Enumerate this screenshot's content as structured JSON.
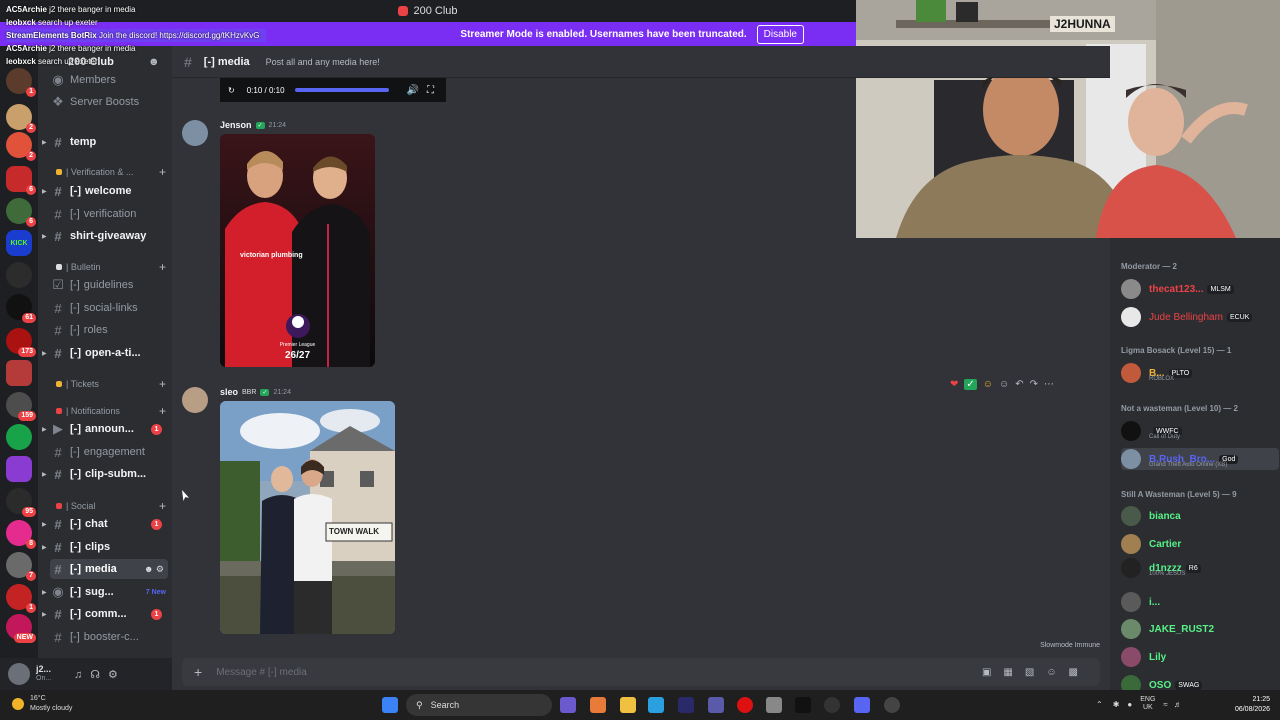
{
  "window": {
    "title": "200 Club"
  },
  "streamer_banner": {
    "text": "Streamer Mode is enabled. Usernames have been truncated.",
    "button": "Disable"
  },
  "overlay_chat": [
    {
      "user": "AC5Archie",
      "text": "j2 there banger in media"
    },
    {
      "user": "leobxck",
      "text": "search up exeter"
    },
    {
      "user": "StreamElements BotRix",
      "text": "Join the discord! https://discord.gg/tKHzvKvG"
    },
    {
      "user": "AC5Archie",
      "text": "j2 there banger in media"
    },
    {
      "user": "leobxck",
      "text": "search up exeter"
    }
  ],
  "server_rail": {
    "badges": [
      "1",
      "2",
      "2",
      "6",
      "6",
      "61",
      "173",
      "159",
      "95",
      "8",
      "7",
      "1",
      "NEW"
    ],
    "kick_label": "KICK"
  },
  "sidebar": {
    "server_name": "200 Club",
    "top_items": [
      "Members",
      "Server Boosts"
    ],
    "channels": {
      "temp": "temp",
      "verif_cat": "| Verification & ...",
      "welcome": "welcome",
      "verification": "verification",
      "giveaway": "shirt-giveaway",
      "bulletin_cat": "| Bulletin",
      "guidelines": "guidelines",
      "social_links": "social-links",
      "roles": "roles",
      "open_ti": "open-a-ti...",
      "tickets_cat": "| Tickets",
      "notif_cat": "| Notifications",
      "announ": "announ...",
      "engagement": "engagement",
      "clip_subm": "clip-subm...",
      "social_cat": "| Social",
      "chat": "chat",
      "clips": "clips",
      "media": "media",
      "sug": "sug...",
      "comm": "comm...",
      "booster": "booster-c..."
    },
    "prefix": "[-]",
    "counts": {
      "announ": "1",
      "chat": "1",
      "comm": "1"
    },
    "new_label": "7 New"
  },
  "user_panel": {
    "name": "j2...",
    "status": "On..."
  },
  "channel_header": {
    "name": "media",
    "prefix": "[-]",
    "topic": "Post all and any media here!"
  },
  "video": {
    "time": "0:10 / 0:10",
    "progress": 1.0
  },
  "messages": [
    {
      "author": "Jenson",
      "time": "21:24",
      "image_caption_league": "Premier League",
      "image_caption_season": "26/27",
      "image_sponsor": "victorian plumbing"
    },
    {
      "author": "sleo",
      "clan": "BBR",
      "time": "21:24",
      "image_sign": "TOWN WALK"
    }
  ],
  "slowmode": "Slowmode Immune",
  "composer": {
    "placeholder": "Message # [-] media"
  },
  "members": {
    "groups": [
      {
        "title": "Moderator — 2",
        "items": [
          {
            "name": "thecat123...",
            "clan": "MLSM",
            "color": "#ed4245"
          },
          {
            "name": "Jude Bellingham",
            "clan": "ECUK",
            "color": "#ed4245"
          }
        ]
      },
      {
        "title": "Ligma Bosack (Level 15) — 1",
        "items": [
          {
            "name": "B...",
            "clan": "PLTO",
            "color": "#f0b232",
            "sub": "ROBLOX"
          }
        ]
      },
      {
        "title": "Not a wasteman (Level 10) — 2",
        "items": [
          {
            "name": "",
            "clan": "WWFC",
            "color": "#f2f3f5",
            "sub": "Call of Duty"
          },
          {
            "name": "B.Rush_Bro...",
            "clan": "God",
            "color": "#5865f2",
            "sub": "Grand Theft Auto Online (XB)"
          }
        ]
      },
      {
        "title": "Still A Wasteman (Level 5) — 9",
        "items": [
          {
            "name": "bianca",
            "color": "#57f287"
          },
          {
            "name": "Cartier",
            "color": "#57f287"
          },
          {
            "name": "d1nzzz",
            "clan": "R6",
            "color": "#57f287",
            "sub": "100% JESUS"
          },
          {
            "name": "i...",
            "color": "#57f287"
          },
          {
            "name": "JAKE_RUST2",
            "color": "#57f287"
          },
          {
            "name": "Lily",
            "color": "#57f287"
          },
          {
            "name": "OSO",
            "clan": "SWAG",
            "color": "#57f287"
          }
        ]
      }
    ]
  },
  "webcam": {
    "sign": "J2HUNNA"
  },
  "taskbar": {
    "weather_temp": "16°C",
    "weather_desc": "Mostly cloudy",
    "search": "Search",
    "lang1": "ENG",
    "lang2": "UK",
    "time": "21:25",
    "date": "06/08/2026"
  }
}
